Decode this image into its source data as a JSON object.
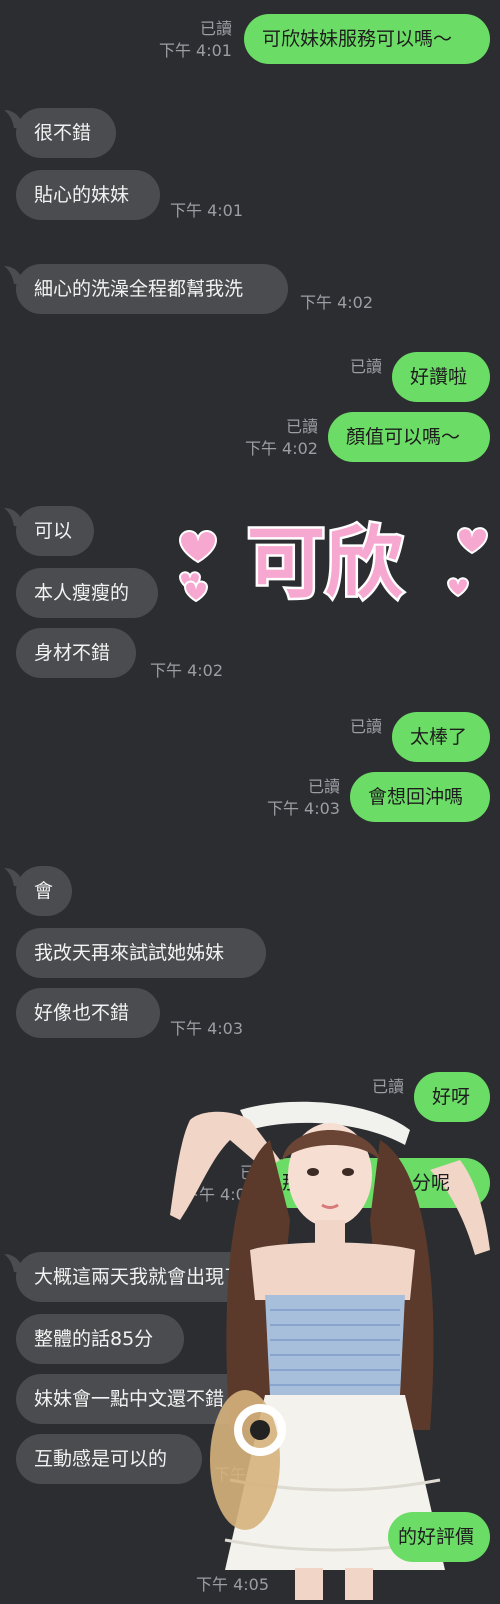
{
  "colors": {
    "background": "#2b2d30",
    "outgoing_bubble": "#6bdc65",
    "incoming_bubble": "#4a4c50",
    "meta_text": "#9b9ea3",
    "sticker_pink": "#f7a8d0"
  },
  "read_label": "已讀",
  "messages": [
    {
      "side": "out",
      "text": "可欣妹妹服務可以嗎～",
      "read": "已讀",
      "time": "下午 4:01"
    },
    {
      "side": "in",
      "text": "很不錯"
    },
    {
      "side": "in",
      "text": "貼心的妹妹",
      "time": "下午 4:01"
    },
    {
      "side": "in",
      "text": "細心的洗澡全程都幫我洗",
      "time": "下午 4:02"
    },
    {
      "side": "out",
      "text": "好讚啦",
      "read": "已讀"
    },
    {
      "side": "out",
      "text": "顏值可以嗎～",
      "read": "已讀",
      "time": "下午 4:02"
    },
    {
      "side": "in",
      "text": "可以"
    },
    {
      "side": "in",
      "text": "本人瘦瘦的"
    },
    {
      "side": "in",
      "text": "身材不錯",
      "time": "下午 4:02"
    },
    {
      "side": "out",
      "text": "太棒了",
      "read": "已讀"
    },
    {
      "side": "out",
      "text": "會想回沖嗎",
      "read": "已讀",
      "time": "下午 4:03"
    },
    {
      "side": "in",
      "text": "會"
    },
    {
      "side": "in",
      "text": "我改天再來試試她姊妹"
    },
    {
      "side": "in",
      "text": "好像也不錯",
      "time": "下午 4:03"
    },
    {
      "side": "out",
      "text": "好呀",
      "read": "已讀"
    },
    {
      "side": "out",
      "text": "那",
      "read": "已",
      "time": "下午 4:04",
      "tail_text": "分呢"
    },
    {
      "side": "in",
      "text": "大概這兩天我就會出現了"
    },
    {
      "side": "in",
      "text": "整體的話85分"
    },
    {
      "side": "in",
      "text": "妹妹會一點中文還不錯"
    },
    {
      "side": "in",
      "text": "互動感是可以的",
      "time": "下午"
    },
    {
      "side": "out",
      "text": "的好評價",
      "time": "下午 4:05"
    }
  ],
  "sticker": {
    "text": "可欣",
    "icon": "hearts-sticker"
  },
  "overlay_photo": {
    "icon": "woman-photo"
  }
}
